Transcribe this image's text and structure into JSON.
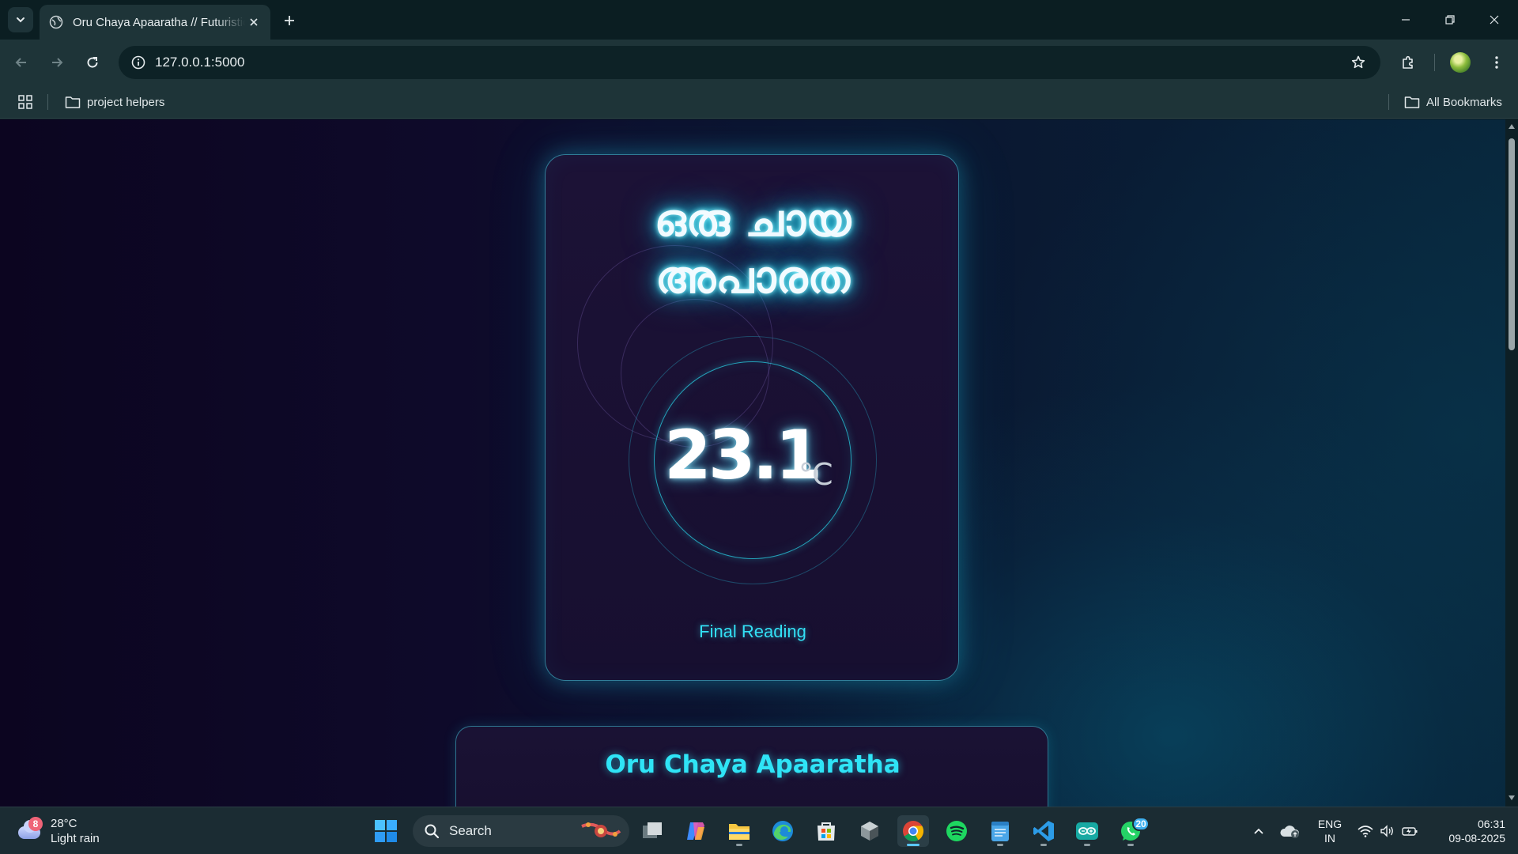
{
  "browser": {
    "tab_title": "Oru Chaya Apaaratha // Futuristic",
    "url": "127.0.0.1:5000",
    "bookmarks": [
      {
        "label": "project helpers"
      },
      {
        "label": "All Bookmarks"
      }
    ]
  },
  "page": {
    "title_line1": "ഒരു ചായ",
    "title_line2": "അപാരത",
    "temperature": "23.1",
    "unit": "°C",
    "caption": "Final Reading",
    "section_title": "Oru Chaya Apaaratha",
    "colors": {
      "accent": "#2fe4f6",
      "background": "#0e0a2a"
    }
  },
  "taskbar": {
    "weather_badge": "8",
    "weather_temp": "28°C",
    "weather_desc": "Light rain",
    "search_label": "Search",
    "apps": [
      "start-icon",
      "task-view-icon",
      "copilot-icon",
      "file-explorer-icon",
      "edge-icon",
      "store-icon",
      "app-icon",
      "chrome-icon",
      "spotify-icon",
      "notepad-icon",
      "vscode-icon",
      "arduino-icon",
      "whatsapp-icon"
    ],
    "whatsapp_badge": "20",
    "lang_line1": "ENG",
    "lang_line2": "IN",
    "time": "06:31",
    "date": "09-08-2025"
  }
}
